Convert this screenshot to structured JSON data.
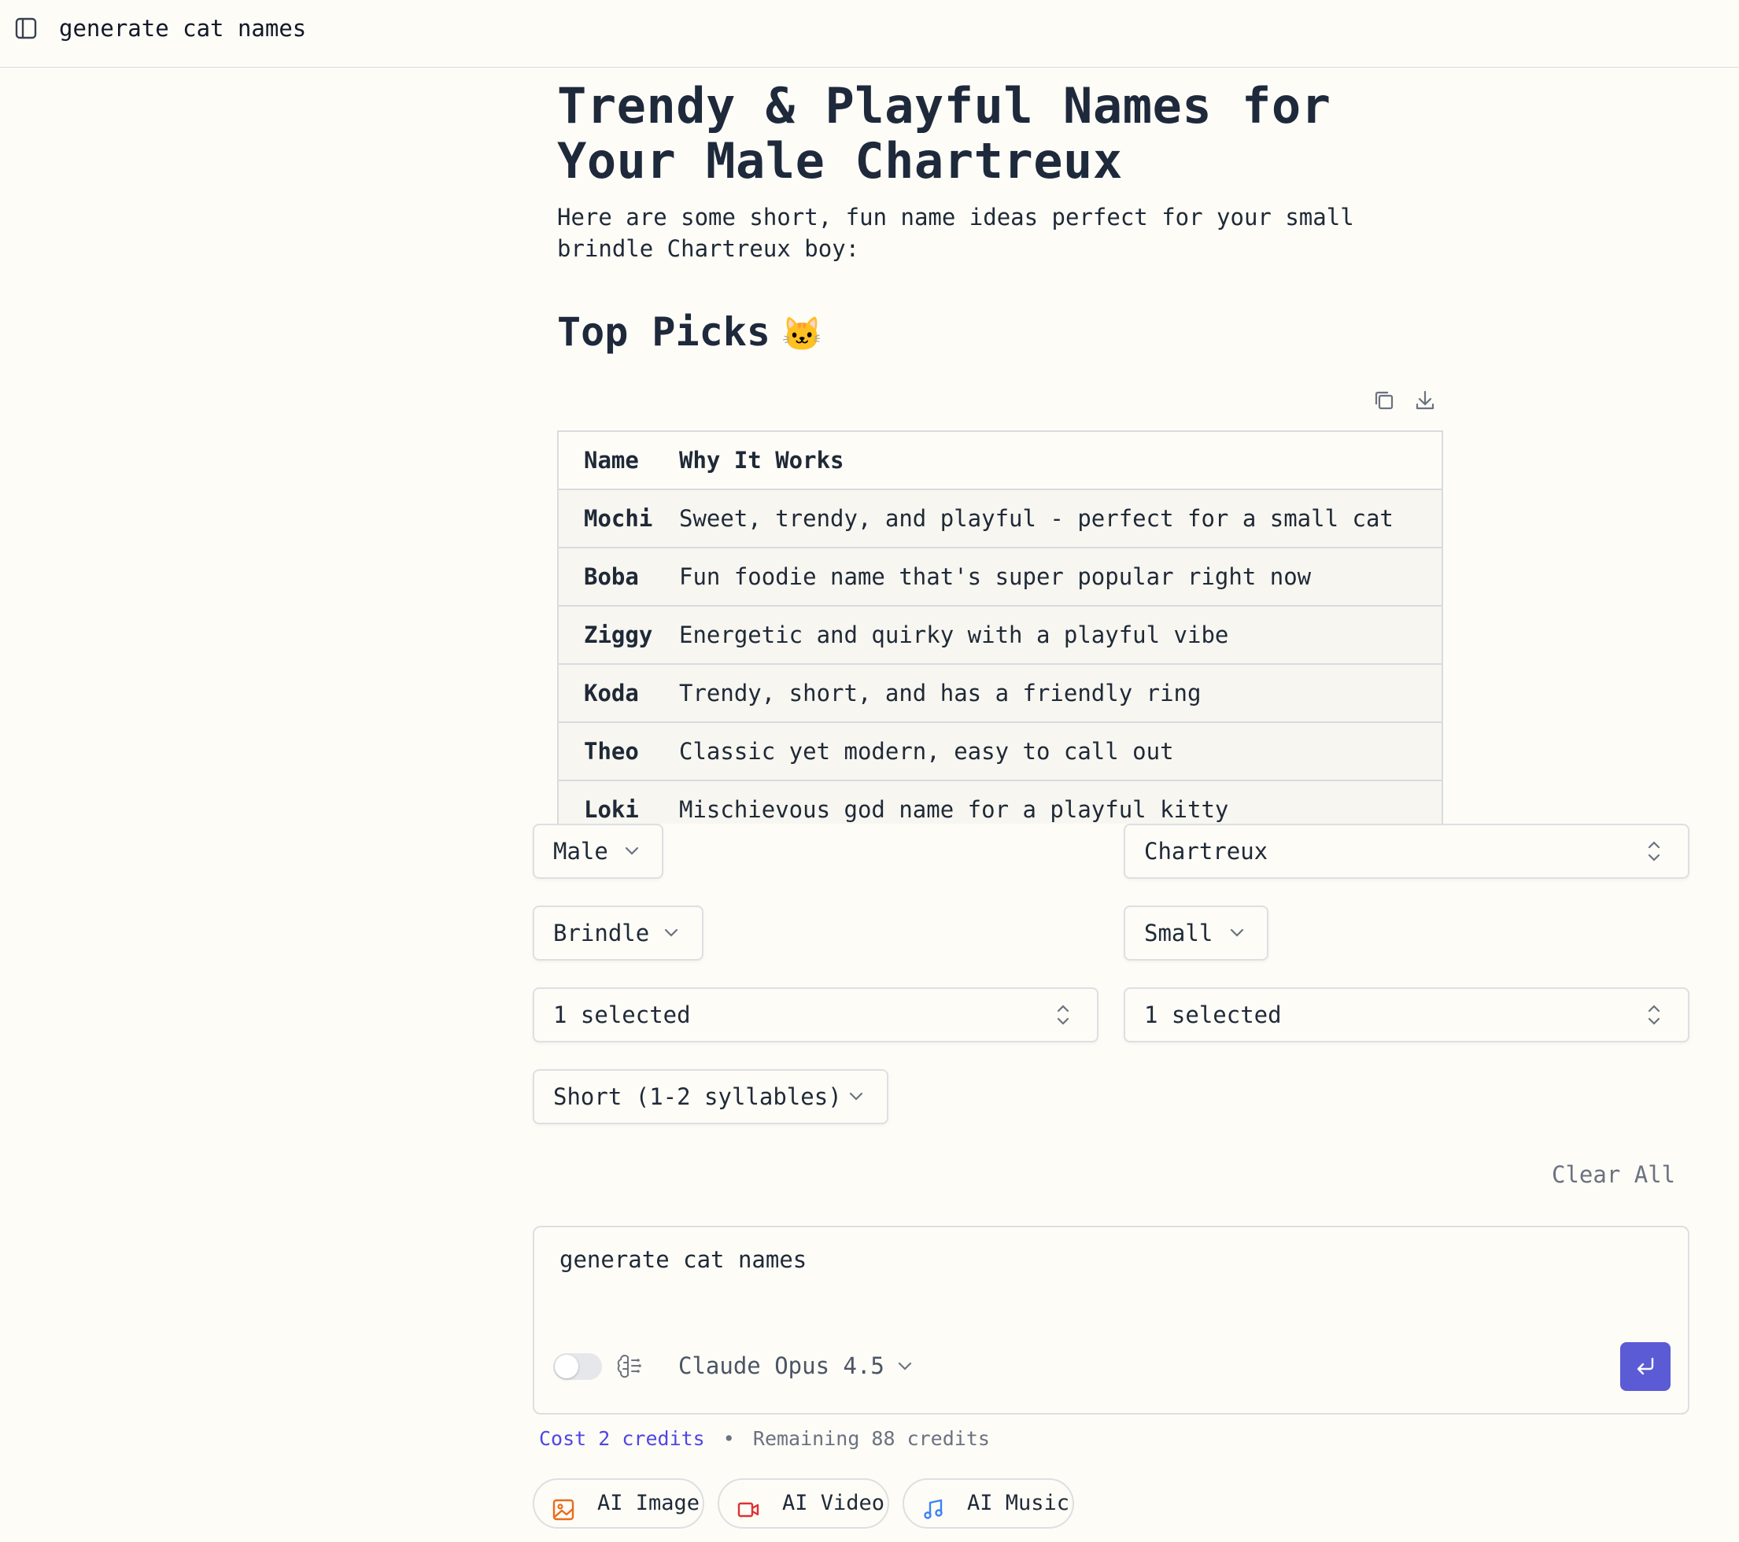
{
  "topbar": {
    "title": "generate cat names"
  },
  "article": {
    "title": "Trendy & Playful Names for Your Male Chartreux",
    "intro": "Here are some short, fun name ideas perfect for your small brindle Chartreux boy:",
    "section_title": "Top Picks",
    "section_emoji": "🐱"
  },
  "table": {
    "headers": [
      "Name",
      "Why It Works"
    ],
    "rows": [
      [
        "Mochi",
        "Sweet, trendy, and playful - perfect for a small cat"
      ],
      [
        "Boba",
        "Fun foodie name that's super popular right now"
      ],
      [
        "Ziggy",
        "Energetic and quirky with a playful vibe"
      ],
      [
        "Koda",
        "Trendy, short, and has a friendly ring"
      ],
      [
        "Theo",
        "Classic yet modern, easy to call out"
      ],
      [
        "Loki",
        "Mischievous god name for a playful kitty"
      ]
    ]
  },
  "filters": {
    "gender": "Male",
    "breed": "Chartreux",
    "coat": "Brindle",
    "size": "Small",
    "multi_left": "1 selected",
    "multi_right": "1 selected",
    "length": "Short (1-2 syllables)"
  },
  "clear_all": "Clear All",
  "composer": {
    "prompt": "generate cat names",
    "model": "Claude Opus 4.5",
    "thinking_enabled": false
  },
  "credits": {
    "cost": "Cost 2 credits",
    "separator": "•",
    "remaining": "Remaining 88 credits"
  },
  "tools": [
    {
      "label": "AI Image",
      "icon": "image-icon",
      "color": "#ea6b1a"
    },
    {
      "label": "AI Video",
      "icon": "video-icon",
      "color": "#e03131"
    },
    {
      "label": "AI Music",
      "icon": "music-icon",
      "color": "#3b82f6"
    }
  ],
  "colors": {
    "accent": "#5b5bd6",
    "background": "#fdfcf7",
    "link": "#4f46e5"
  }
}
